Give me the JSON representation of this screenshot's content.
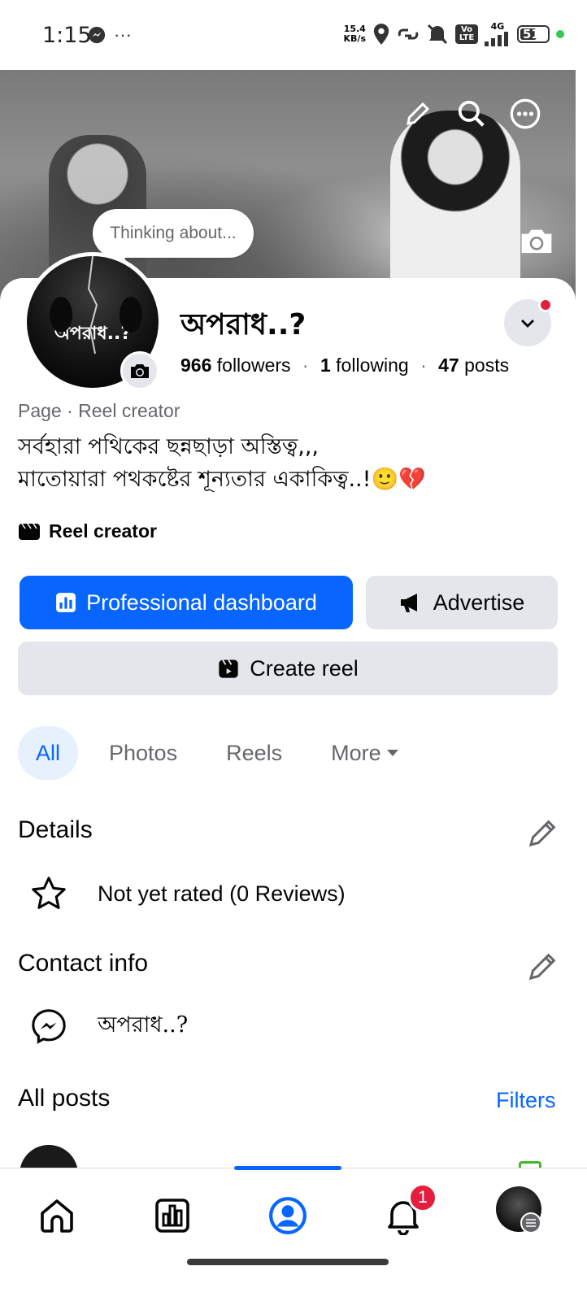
{
  "status_bar": {
    "time": "1:15",
    "overflow": "···",
    "speed_value": "15.4",
    "speed_unit": "KB/s",
    "volte": "Vo LTE",
    "network": "4G",
    "battery": "51"
  },
  "cover": {
    "actions": [
      "pencil-icon",
      "search-icon",
      "more-icon"
    ],
    "camera": "camera-icon"
  },
  "profile": {
    "thought_bubble": "Thinking about...",
    "avatar_text": "অপরাধ..?",
    "name": "অপরাধ..?",
    "followers_count": "966",
    "followers_label": "followers",
    "following_count": "1",
    "following_label": "following",
    "posts_count": "47",
    "posts_label": "posts",
    "category": "Page · Reel creator",
    "bio_line1": "সর্বহারা পথিকের ছন্নছাড়া অস্তিত্ব,,,",
    "bio_line2": "মাতোয়ারা পথকষ্টের শূন্যতার একাকিত্ব..!🙂💔",
    "reel_tag": "Reel creator"
  },
  "actions": {
    "professional_dashboard": "Professional dashboard",
    "advertise": "Advertise",
    "create_reel": "Create reel"
  },
  "tabs": [
    {
      "label": "All",
      "active": true
    },
    {
      "label": "Photos",
      "active": false
    },
    {
      "label": "Reels",
      "active": false
    },
    {
      "label": "More",
      "active": false
    }
  ],
  "details": {
    "title": "Details",
    "rating": "Not yet rated (0 Reviews)"
  },
  "contact": {
    "title": "Contact info",
    "messenger": "অপরাধ..?"
  },
  "posts": {
    "title": "All posts",
    "filters": "Filters"
  },
  "bottom_nav": {
    "items": [
      "home-icon",
      "dashboard-icon",
      "profile-icon",
      "notifications-icon",
      "menu-avatar"
    ],
    "notification_count": "1",
    "active": "profile-icon"
  },
  "colors": {
    "accent": "#0866ff",
    "secondary_bg": "#e4e6eb",
    "muted_text": "#65676b",
    "badge_red": "#e41e3f"
  }
}
